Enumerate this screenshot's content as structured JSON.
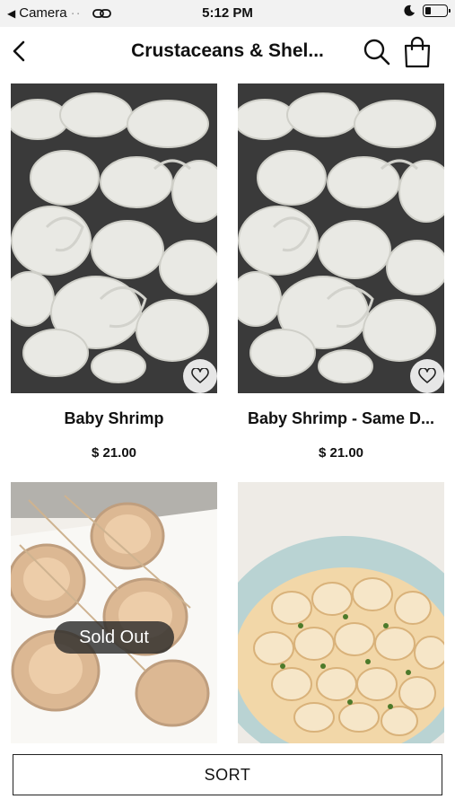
{
  "status_bar": {
    "back_app": "Camera",
    "time": "5:12 PM"
  },
  "header": {
    "title": "Crustaceans & Shel..."
  },
  "products": [
    {
      "name": "Baby Shrimp",
      "price": "$ 21.00",
      "image": "shrimp"
    },
    {
      "name": "Baby Shrimp - Same D...",
      "price": "$ 21.00",
      "image": "shrimp"
    },
    {
      "name": "",
      "price": "",
      "image": "seared-scallops",
      "badge": "Sold Out"
    },
    {
      "name": "",
      "price": "",
      "image": "bay-scallops"
    }
  ],
  "sort_button": {
    "label": "SORT"
  },
  "colors": {
    "header_bg": "#ffffff",
    "status_bg": "#f2f2f2",
    "badge_bg": "#2d2d2d"
  }
}
